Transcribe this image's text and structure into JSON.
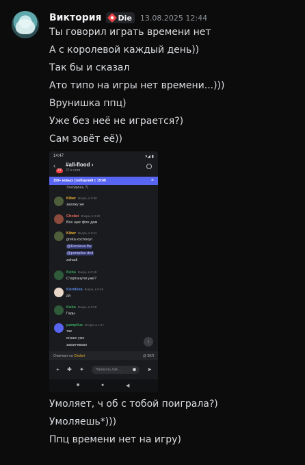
{
  "message": {
    "username": "Виктория",
    "tag_label": "Die",
    "timestamp": "13.08.2025 12:44",
    "lines_before": [
      "Ты говорил играть времени нет",
      "А с королевой каждый день))",
      "Так бы и сказал",
      "Ато типо на игры нет времени...)))",
      "Врунишка ппц)",
      "Уже без неё не играется?)",
      "Сам зовёт её))"
    ],
    "lines_after": [
      "Умоляет, ч об с тобой поиграла?)",
      "Умоляешь*)))",
      "Ппц времени нет на игру)"
    ]
  },
  "attachment": {
    "status_time": "14:47",
    "status_right": "▾◢ ▮",
    "channel": "all-flood",
    "channel_sub": "22 в сети",
    "badge": "37",
    "banner_text": "150+ новых сообщений с 19:48",
    "prev_line": "Заходишь ?)",
    "messages": [
      {
        "name": "Kiber",
        "color": "#f0b232",
        "meta": "Вчера, в 0:38",
        "lines": [
          "захожу же"
        ]
      },
      {
        "name": "Chobei",
        "color": "#ed6a5e",
        "meta": "Вчера, в 0:40",
        "lines": [
          "Все щас фле дам"
        ]
      },
      {
        "name": "Kiber",
        "color": "#f0b232",
        "meta": "Вчера, в 0:41",
        "lines": [
          "greka костонул",
          "@Koroleva flw",
          "@pampilus ded",
          "zahadi"
        ]
      },
      {
        "name": "Kuba",
        "color": "#3ba55d",
        "meta": "Вчера, в 0:49",
        "lines": [
          "Стартанули уже?"
        ]
      },
      {
        "name": "Koroleva",
        "color": "#5b8def",
        "meta": "Вчера, в 0:49",
        "lines": [
          "да"
        ]
      },
      {
        "name": "Kuba",
        "color": "#3ba55d",
        "meta": "Вчера, в 0:50",
        "lines": [
          "Гады"
        ]
      },
      {
        "name": "pampilus",
        "color": "#3ba55d",
        "meta": "Вчера, в 1:17",
        "lines": [
          "так",
          "играю уже",
          "заканчиваю"
        ]
      }
    ],
    "reply_prefix": "Отвечает на",
    "reply_name": "Chobei",
    "reply_right": "@ ВКЛ",
    "input_placeholder": "Написать #all-..."
  }
}
